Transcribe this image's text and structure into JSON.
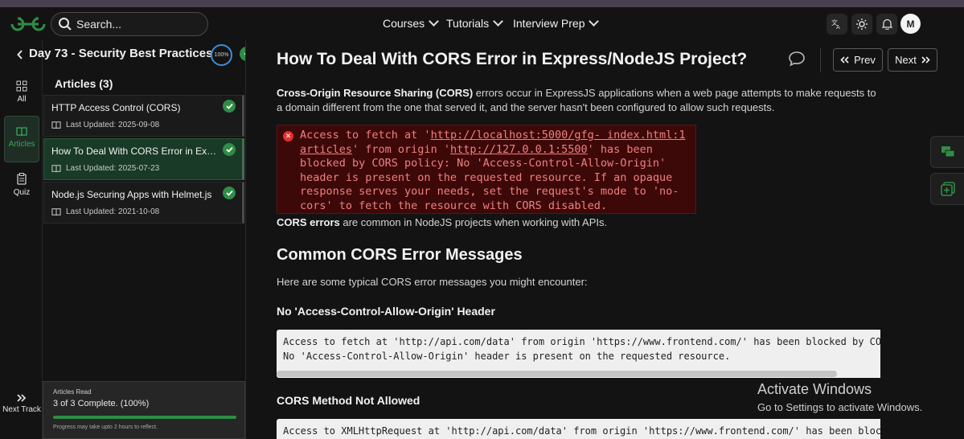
{
  "header": {
    "search_placeholder": "Search...",
    "nav": [
      {
        "label": "Courses"
      },
      {
        "label": "Tutorials"
      },
      {
        "label": "Interview Prep"
      }
    ],
    "avatar_initial": "M"
  },
  "sidebar": {
    "rail": [
      {
        "label": "All",
        "icon": "grid-icon"
      },
      {
        "label": "Articles",
        "icon": "book-icon",
        "active": true
      },
      {
        "label": "Quiz",
        "icon": "clipboard-icon"
      }
    ],
    "day_title": "Day 73 - Security Best Practices",
    "progress_label": "100%",
    "articles_heading": "Articles (3)",
    "articles": [
      {
        "title": "HTTP Access Control (CORS)",
        "updated": "Last Updated: 2025-09-08",
        "completed": true,
        "active": false
      },
      {
        "title": "How To Deal With CORS Error in Express/NodeJS Project?",
        "updated": "Last Updated: 2025-07-23",
        "completed": true,
        "active": true
      },
      {
        "title": "Node.js Securing Apps with Helmet.js",
        "updated": "Last Updated: 2021-10-08",
        "completed": true,
        "active": false
      }
    ],
    "read_box": {
      "label": "Articles Read",
      "status": "3 of 3 Complete. (100%)",
      "progress": 1.0,
      "note": "Progress may take upto 2 hours to reflect."
    },
    "next_track": "Next Track"
  },
  "article": {
    "title": "How To Deal With CORS Error in Express/NodeJS Project?",
    "prev_label": "Prev",
    "next_label": "Next",
    "intro_bold": "Cross-Origin Resource Sharing (CORS)",
    "intro_rest": " errors occur in ExpressJS applications when a web page attempts to make requests to a domain different from the one that served it, and the server hasn't been configured to allow such requests.",
    "error_lines": {
      "l1_pre": "Access to fetch at '",
      "l1_link": "http://localhost:5000/gfg- index.html:1",
      "l2_link": "articles",
      "l2_mid": "' from origin '",
      "l2_link2": "http://127.0.0.1:5500",
      "l2_post": "' has been",
      "l3": "blocked by CORS policy: No 'Access-Control-Allow-Origin'",
      "l4": "header is present on the requested resource. If an opaque",
      "l5": "response serves your needs, set the request's mode to 'no-",
      "l6": "cors' to fetch the resource with CORS disabled."
    },
    "cors_bold": "CORS errors",
    "cors_rest": " are common in NodeJS projects when working with APIs.",
    "section_heading": "Common CORS Error Messages",
    "section_intro": "Here are some typical CORS error messages you might encounter:",
    "sub1": "No 'Access-Control-Allow-Origin' Header",
    "code1_line1": "Access to fetch at 'http://api.com/data' from origin 'https://www.frontend.com/' has been blocked by CORS p",
    "code1_line2": "No 'Access-Control-Allow-Origin' header is present on the requested resource.",
    "sub2": "CORS Method Not Allowed",
    "code2_line1": "Access to XMLHttpRequest at 'http://api.com/data' from origin 'https://www.frontend.com/' has been blocked"
  },
  "watermark": {
    "line1": "Activate Windows",
    "line2": "Go to Settings to activate Windows."
  },
  "colors": {
    "accent": "#2f8d46",
    "background": "#131313",
    "error_bg": "#3d0808",
    "error_text": "#f08080"
  }
}
